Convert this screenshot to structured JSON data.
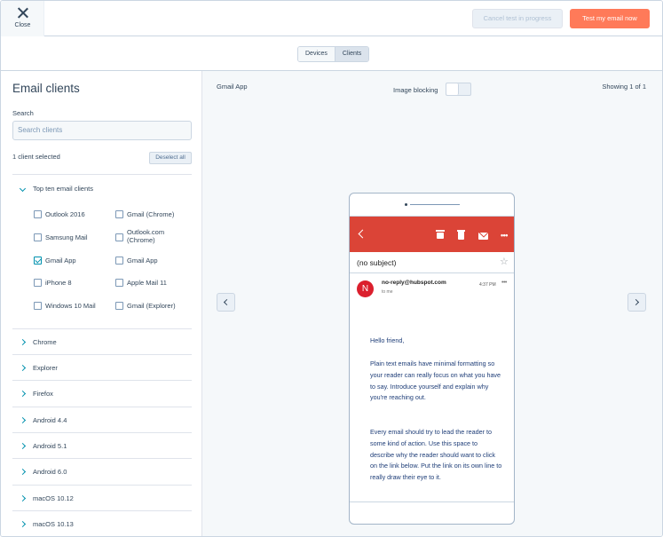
{
  "topbar": {
    "close_label": "Close",
    "cancel_label": "Cancel test in progress",
    "test_label": "Test my email now"
  },
  "tabs": [
    {
      "label": "Devices",
      "active": false
    },
    {
      "label": "Clients",
      "active": true
    }
  ],
  "sidebar": {
    "title": "Email clients",
    "search_label": "Search",
    "search_placeholder": "Search clients",
    "selected_count": "1 client selected",
    "deselect_label": "Deselect all",
    "group_title": "Top ten email clients",
    "clients": [
      {
        "label": "Outlook 2016",
        "checked": false
      },
      {
        "label": "Gmail (Chrome)",
        "checked": false
      },
      {
        "label": "Samsung Mail",
        "checked": false
      },
      {
        "label": "Outlook.com\n(Chrome)",
        "checked": false
      },
      {
        "label": "Gmail App",
        "checked": true
      },
      {
        "label": "Gmail App",
        "checked": false
      },
      {
        "label": "iPhone 8",
        "checked": false
      },
      {
        "label": "Apple Mail 11",
        "checked": false
      },
      {
        "label": "Windows 10 Mail",
        "checked": false
      },
      {
        "label": "Gmail (Explorer)",
        "checked": false
      }
    ],
    "browsers": [
      "Chrome",
      "Explorer",
      "Firefox",
      "Android 4.4",
      "Android 5.1",
      "Android 6.0",
      "macOS 10.12",
      "macOS 10.13"
    ]
  },
  "preview": {
    "client_name": "Gmail App",
    "image_blocking_label": "Image blocking",
    "image_blocking_on": false,
    "showing": "Showing 1 of 1"
  },
  "email": {
    "subject": "(no subject)",
    "avatar_letter": "N",
    "sender": "no-reply@hubspot.com",
    "to": "to me",
    "time": "4:37 PM",
    "greeting": "Hello friend,",
    "para1": "Plain text emails have minimal formatting so your reader can really focus on what you have to say. Introduce yourself and explain why you're reaching out.",
    "para2": "Every email should try to lead the reader to some kind of action. Use this space to describe why the reader should want to click on the link below. Put the link on its own line to really draw their eye to it."
  },
  "colors": {
    "primary_button": "#ff7a59",
    "gmail_bar": "#db4437",
    "avatar": "#db1f2d",
    "check_accent": "#0091ae"
  }
}
